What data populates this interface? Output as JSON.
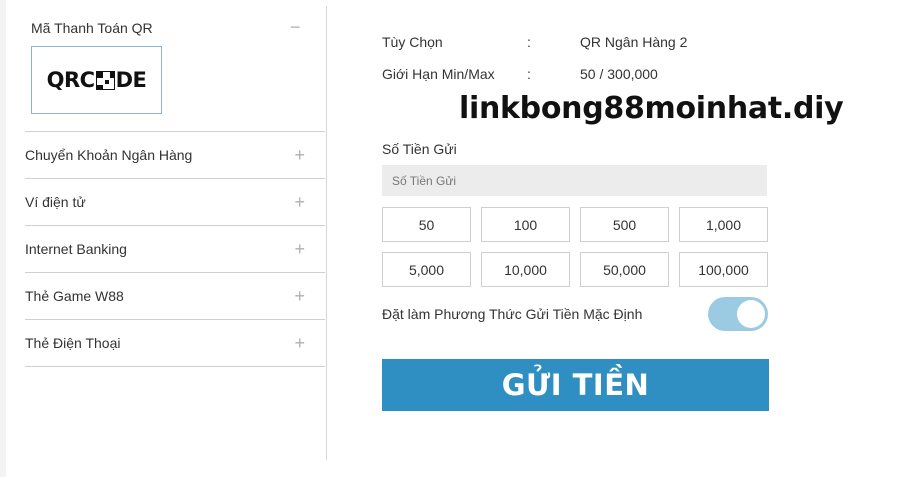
{
  "sidebar": {
    "qr_title": "Mã Thanh Toán QR",
    "qr_logo_text_left": "QRC",
    "qr_logo_text_right": "DE",
    "items": [
      {
        "label": "Chuyển Khoản Ngân Hàng",
        "icon": "plus-icon"
      },
      {
        "label": "Ví điện tử",
        "icon": "plus-icon"
      },
      {
        "label": "Internet Banking",
        "icon": "plus-icon"
      },
      {
        "label": "Thẻ Game W88",
        "icon": "plus-icon"
      },
      {
        "label": "Thẻ Điện Thoại",
        "icon": "plus-icon"
      }
    ],
    "collapse_icon": "minus-icon"
  },
  "info": {
    "option_label": "Tùy Chọn",
    "option_value": "QR Ngân Hàng 2",
    "limit_label": "Giới Hạn Min/Max",
    "limit_value": "50 / 300,000",
    "colon": ":"
  },
  "watermark": "linkbong88moinhat.diy",
  "deposit": {
    "amount_label": "Số Tiền Gửi",
    "amount_placeholder": "Số Tiền Gửi",
    "amount_value": "",
    "quick_amounts": [
      "50",
      "100",
      "500",
      "1,000",
      "5,000",
      "10,000",
      "50,000",
      "100,000"
    ],
    "default_toggle_label": "Đặt làm Phương Thức Gửi Tiền Mặc Định",
    "default_toggle_on": true,
    "submit_label": "GỬI TIỀN"
  },
  "colors": {
    "accent": "#2f8fc3",
    "toggle_on": "#9bcbe2",
    "input_bg": "#ececec"
  }
}
